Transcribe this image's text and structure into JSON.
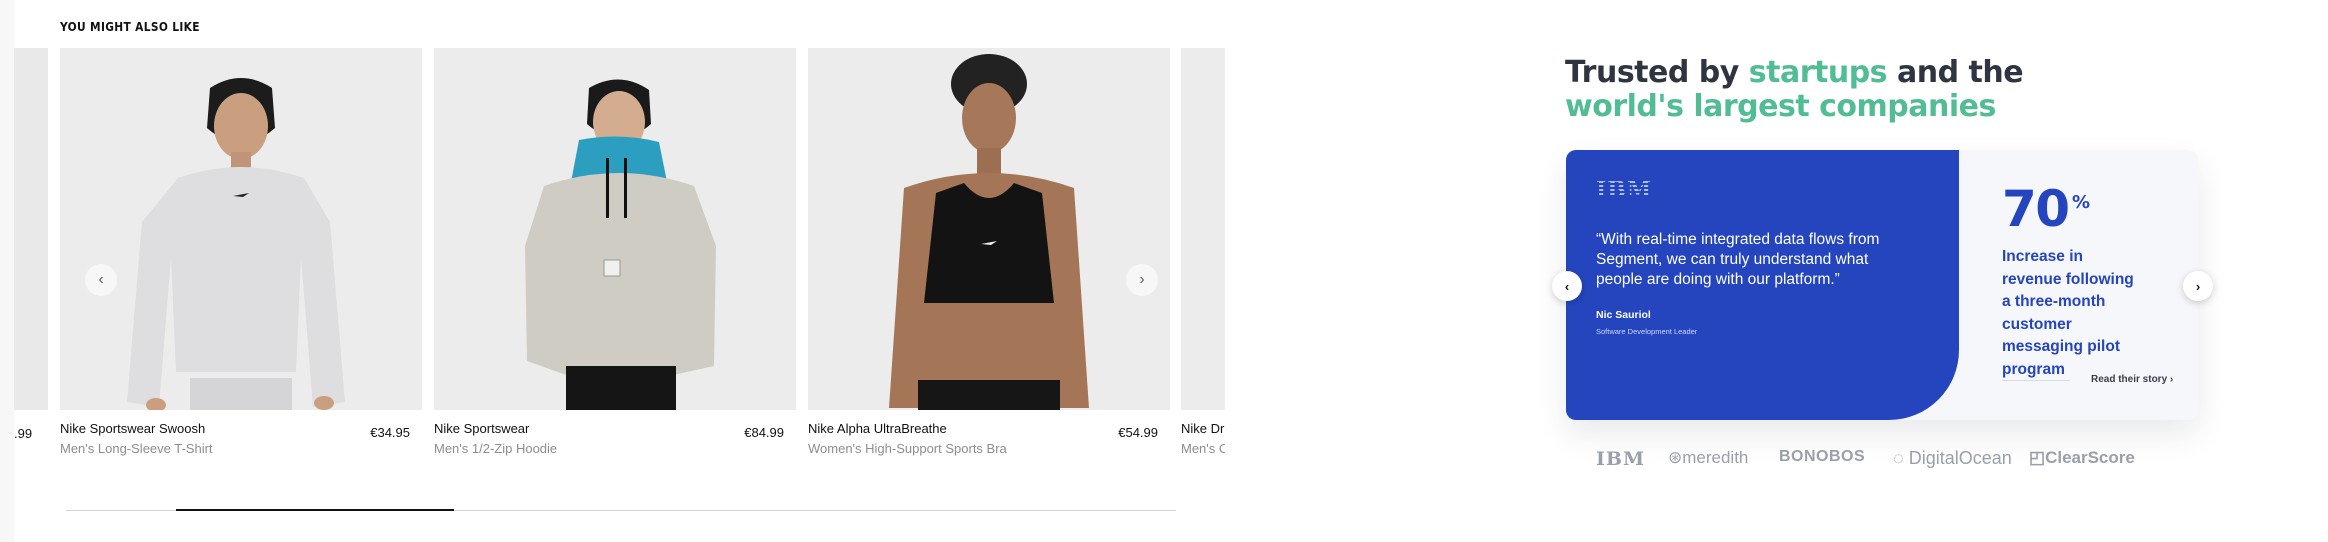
{
  "carousel": {
    "title": "YOU MIGHT ALSO LIKE",
    "peek_left_price": ".99",
    "peek_right_name": "Nike Dri",
    "peek_right_subtitle": "Men's C",
    "products": [
      {
        "name": "Nike Sportswear Swoosh",
        "subtitle": "Men's Long-Sleeve T-Shirt",
        "price": "€34.95"
      },
      {
        "name": "Nike Sportswear",
        "subtitle": "Men's 1/2-Zip Hoodie",
        "price": "€84.99"
      },
      {
        "name": "Nike Alpha UltraBreathe",
        "subtitle": "Women's High-Support Sports Bra",
        "price": "€54.99"
      }
    ],
    "prev_icon": "‹",
    "next_icon": "›",
    "scroll_progress": 0.25
  },
  "testimonial": {
    "headline_part1": "Trusted by ",
    "headline_highlight1": "startups",
    "headline_part2": " and the",
    "headline_highlight2": "world's largest companies",
    "company_logo": "IBM",
    "quote": "“With real-time integrated data flows from Segment, we can truly understand what people are doing with our platform.”",
    "person_name": "Nic Sauriol",
    "person_role": "Software Development Leader",
    "stat_value": "70",
    "stat_unit": "%",
    "stat_description": "Increase in revenue following a three-month customer messaging pilot program",
    "story_link": "Read their story",
    "prev_icon": "‹",
    "next_icon": "›"
  },
  "logos": [
    "IBM",
    "meredith",
    "BONOBOS",
    "DigitalOcean",
    "ClearScore"
  ],
  "colors": {
    "accent_green": "#52bd95",
    "brand_blue": "#2445bd",
    "headline_dark": "#2f3441"
  }
}
